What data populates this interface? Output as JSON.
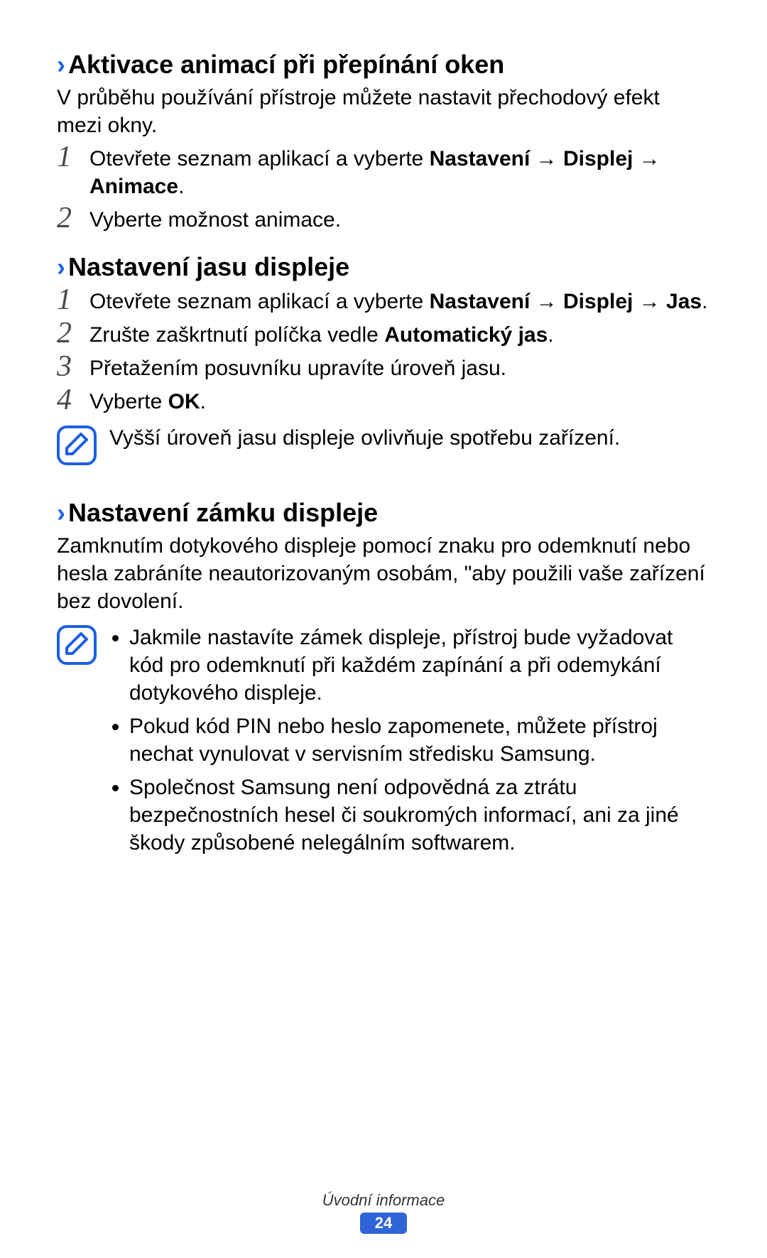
{
  "sections": [
    {
      "title": "Aktivace animací při přepínání oken",
      "intro": "V průběhu používání přístroje můžete nastavit přechodový efekt mezi okny.",
      "steps": [
        {
          "pre": "Otevřete seznam aplikací a vyberte ",
          "bold": "Nastavení → Displej → Animace",
          "post": "."
        },
        {
          "plain": "Vyberte možnost animace."
        }
      ]
    },
    {
      "title": "Nastavení jasu displeje",
      "steps": [
        {
          "pre": "Otevřete seznam aplikací a vyberte ",
          "bold": "Nastavení → Displej → Jas",
          "post": "."
        },
        {
          "pre": "Zrušte zaškrtnutí políčka vedle ",
          "bold": "Automatický jas",
          "post": "."
        },
        {
          "plain": "Přetažením posuvníku upravíte úroveň jasu."
        },
        {
          "pre": "Vyberte ",
          "bold": "OK",
          "post": "."
        }
      ],
      "note_single": "Vyšší úroveň jasu displeje ovlivňuje spotřebu zařízení."
    },
    {
      "title": "Nastavení zámku displeje",
      "intro": "Zamknutím dotykového displeje pomocí znaku pro odemknutí nebo hesla zabráníte neautorizovaným osobám, \"aby použili vaše zařízení bez dovolení.",
      "note_list": [
        "Jakmile nastavíte zámek displeje, přístroj bude vyžadovat kód pro odemknutí při každém zapínání a při odemykání dotykového displeje.",
        "Pokud kód PIN nebo heslo zapomenete, můžete přístroj nechat vynulovat v servisním středisku Samsung.",
        "Společnost Samsung není odpovědná za ztrátu bezpečnostních hesel či soukromých informací, ani za jiné škody způsobené nelegálním softwarem."
      ]
    }
  ],
  "footer": {
    "label": "Úvodní informace",
    "page": "24"
  },
  "step_nums": [
    "1",
    "2",
    "3",
    "4"
  ],
  "chevron": "›",
  "icon": "note-pencil-icon"
}
